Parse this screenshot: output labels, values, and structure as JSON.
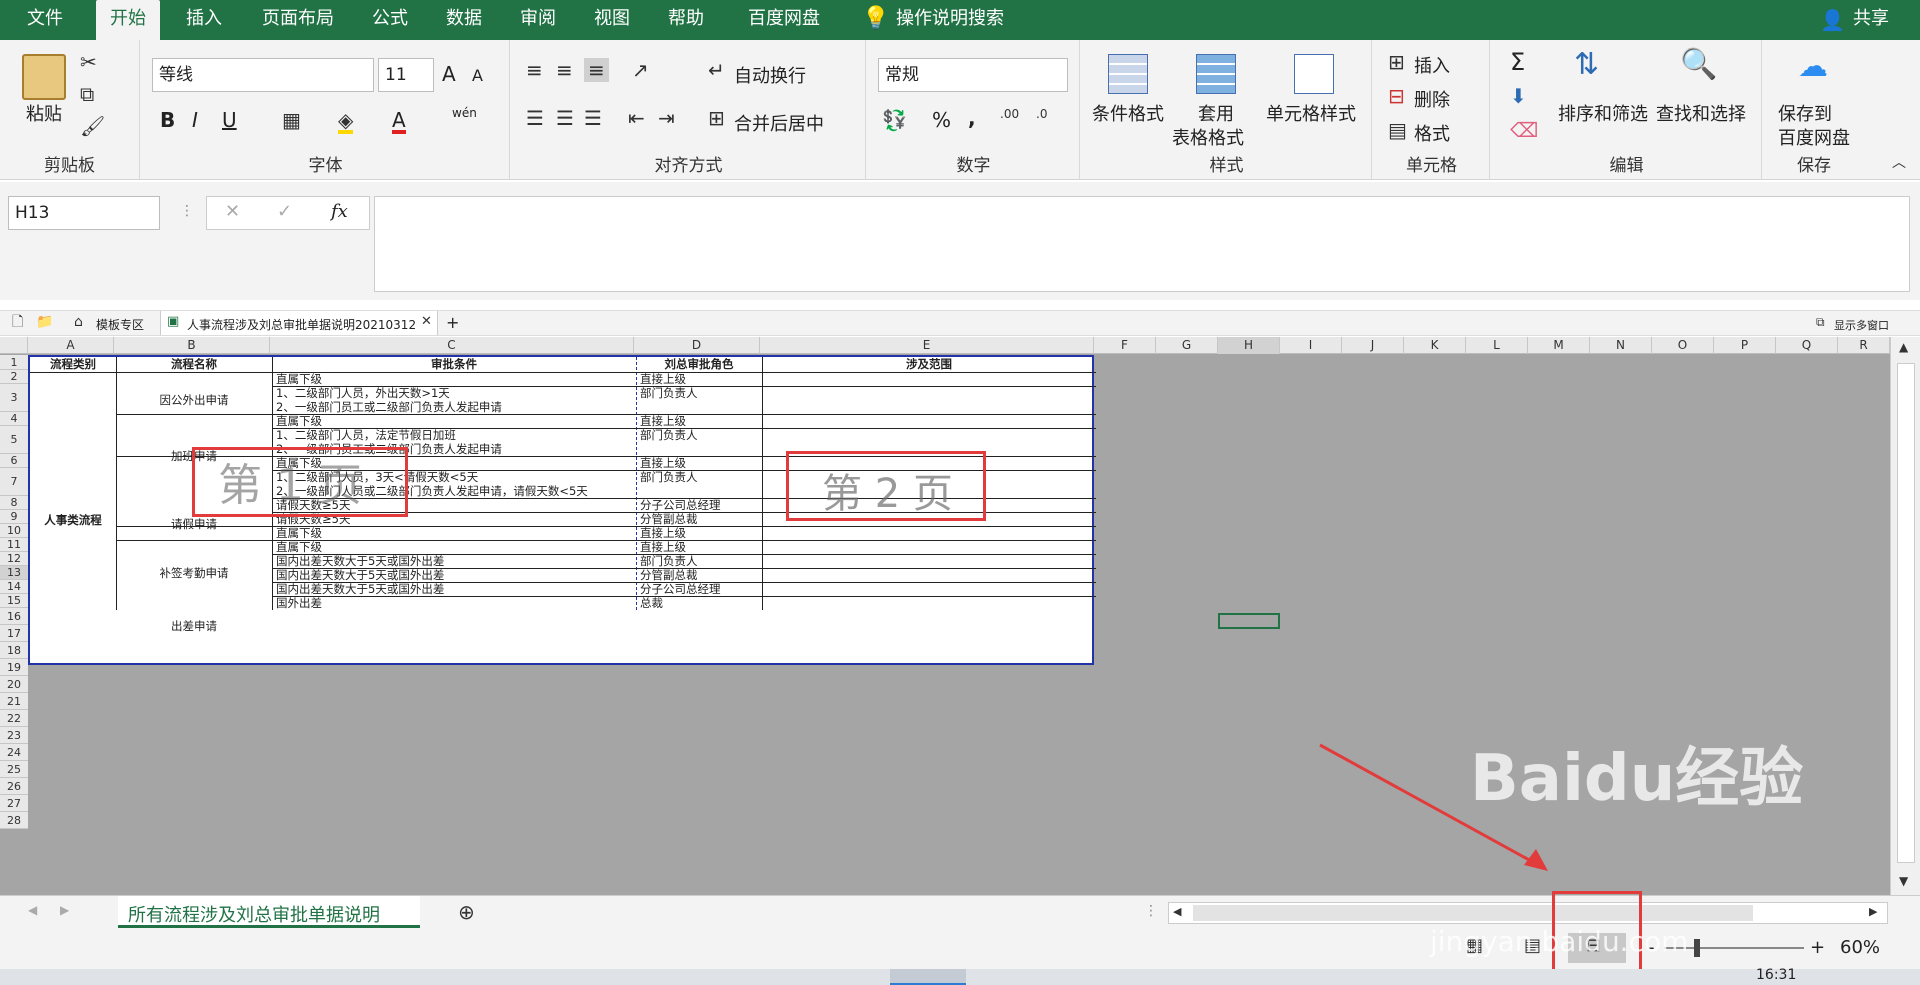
{
  "menu": {
    "tabs": [
      "文件",
      "开始",
      "插入",
      "页面布局",
      "公式",
      "数据",
      "审阅",
      "视图",
      "帮助",
      "百度网盘",
      "操作说明搜索"
    ],
    "active": "开始",
    "share": "共享"
  },
  "ribbon": {
    "clipboard": {
      "paste": "粘贴",
      "label": "剪贴板"
    },
    "font": {
      "name": "等线",
      "size": "11",
      "bold": "B",
      "italic": "I",
      "underline": "U",
      "grow": "A",
      "shrink": "A",
      "wen": "wén",
      "label": "字体"
    },
    "align": {
      "wrap": "自动换行",
      "merge": "合并后居中",
      "label": "对齐方式"
    },
    "number": {
      "format": "常规",
      "percent": "%",
      "comma": ",",
      "label": "数字"
    },
    "styles": {
      "cond": "条件格式",
      "table1": "套用",
      "table2": "表格格式",
      "cell": "单元格样式",
      "label": "样式"
    },
    "cells": {
      "insert": "插入",
      "delete": "删除",
      "format": "格式",
      "label": "单元格"
    },
    "edit": {
      "sigma": "Σ",
      "sort": "排序和筛选",
      "find": "查找和选择",
      "label": "编辑"
    },
    "save": {
      "l1": "保存到",
      "l2": "百度网盘",
      "label": "保存"
    }
  },
  "formula": {
    "namebox": "H13",
    "fx": "fx",
    "cancel": "✕",
    "confirm": "✓"
  },
  "docbar": {
    "template": "模板专区",
    "file": "人事流程涉及刘总审批单据说明20210312",
    "multi": "显示多窗口",
    "plus": "+"
  },
  "columns": [
    "A",
    "B",
    "C",
    "D",
    "E",
    "F",
    "G",
    "H",
    "I",
    "J",
    "K",
    "L",
    "M",
    "N",
    "O",
    "P",
    "Q",
    "R"
  ],
  "rows": [
    "1",
    "2",
    "3",
    "4",
    "5",
    "6",
    "7",
    "8",
    "9",
    "10",
    "11",
    "12",
    "13",
    "14",
    "15",
    "16",
    "17",
    "18",
    "19",
    "20",
    "21",
    "22",
    "23",
    "24",
    "25",
    "26",
    "27",
    "28"
  ],
  "table": {
    "headers": [
      "流程类别",
      "流程名称",
      "审批条件",
      "刘总审批角色",
      "涉及范围"
    ],
    "category": "人事类流程",
    "names": [
      "因公外出申请",
      "加班申请",
      "请假申请",
      "补签考勤申请",
      "出差申请"
    ],
    "conditions": [
      "直属下级",
      "1、二级部门人员，外出天数>1天",
      "2、一级部门员工或二级部门负责人发起申请",
      "直属下级",
      "1、二级部门人员，法定节假日加班",
      "2、一级部门员工或二级部门负责人发起申请",
      "直属下级",
      "1、二级部门人员，3天<请假天数<5天",
      "2、一级部门人员或二级部门负责人发起申请，请假天数<5天",
      "请假天数≥5天",
      "请假天数≥5天",
      "直属下级",
      "直属下级",
      "国内出差天数大于5天或国外出差",
      "国内出差天数大于5天或国外出差",
      "国内出差天数大于5天或国外出差",
      "国外出差"
    ],
    "roles": [
      "直接上级",
      "部门负责人",
      "直接上级",
      "部门负责人",
      "直接上级",
      "部门负责人",
      "分子公司总经理",
      "分管副总裁",
      "直接上级",
      "直接上级",
      "部门负责人",
      "分管副总裁",
      "分子公司总经理",
      "总裁"
    ]
  },
  "pages": {
    "p1": "第 1 页",
    "p2": "第 2 页"
  },
  "sheettab": {
    "name": "所有流程涉及刘总审批单据说明"
  },
  "status": {
    "zoom": "60%",
    "minus": "-",
    "plus": "+"
  },
  "watermark": {
    "brand": "Baidu经验",
    "url": "jingyan.baidu.com"
  },
  "taskbar": {
    "time": "16:31"
  },
  "colors": {
    "excel_green": "#217346",
    "page_border": "#2233aa",
    "annotation": "#e23b3b"
  }
}
